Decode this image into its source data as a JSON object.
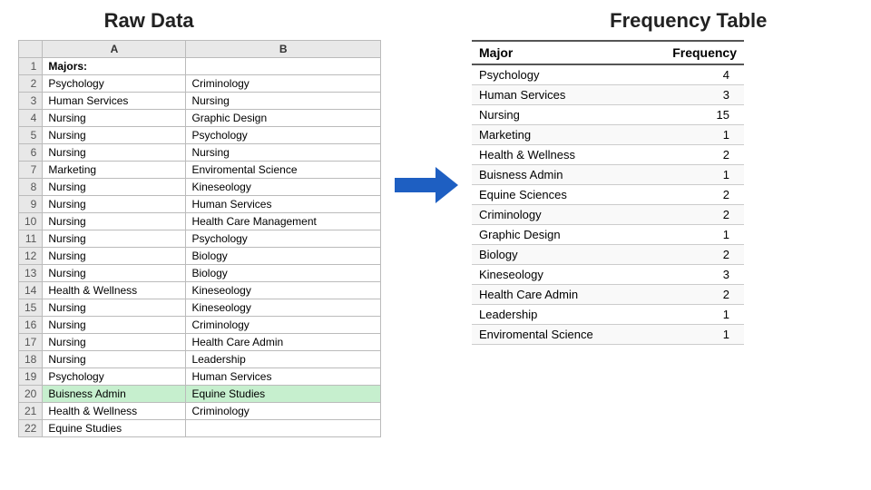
{
  "titles": {
    "raw_data": "Raw Data",
    "frequency_table": "Frequency Table"
  },
  "raw_data": {
    "col_headers": [
      "",
      "A",
      "B"
    ],
    "rows": [
      {
        "num": "1",
        "a": "Majors:",
        "b": "",
        "highlight": false
      },
      {
        "num": "2",
        "a": "Psychology",
        "b": "Criminology",
        "highlight": false
      },
      {
        "num": "3",
        "a": "Human Services",
        "b": "Nursing",
        "highlight": false
      },
      {
        "num": "4",
        "a": "Nursing",
        "b": "Graphic Design",
        "highlight": false
      },
      {
        "num": "5",
        "a": "Nursing",
        "b": "Psychology",
        "highlight": false
      },
      {
        "num": "6",
        "a": "Nursing",
        "b": "Nursing",
        "highlight": false
      },
      {
        "num": "7",
        "a": "Marketing",
        "b": "Enviromental Science",
        "highlight": false
      },
      {
        "num": "8",
        "a": "Nursing",
        "b": "Kineseology",
        "highlight": false
      },
      {
        "num": "9",
        "a": "Nursing",
        "b": "Human Services",
        "highlight": false
      },
      {
        "num": "10",
        "a": "Nursing",
        "b": "Health Care Management",
        "highlight": false
      },
      {
        "num": "11",
        "a": "Nursing",
        "b": "Psychology",
        "highlight": false
      },
      {
        "num": "12",
        "a": "Nursing",
        "b": "Biology",
        "highlight": false
      },
      {
        "num": "13",
        "a": "Nursing",
        "b": "Biology",
        "highlight": false
      },
      {
        "num": "14",
        "a": "Health & Wellness",
        "b": "Kineseology",
        "highlight": false
      },
      {
        "num": "15",
        "a": "Nursing",
        "b": "Kineseology",
        "highlight": false
      },
      {
        "num": "16",
        "a": "Nursing",
        "b": "Criminology",
        "highlight": false
      },
      {
        "num": "17",
        "a": "Nursing",
        "b": "Health Care Admin",
        "highlight": false
      },
      {
        "num": "18",
        "a": "Nursing",
        "b": "Leadership",
        "highlight": false
      },
      {
        "num": "19",
        "a": "Psychology",
        "b": "Human Services",
        "highlight": false
      },
      {
        "num": "20",
        "a": "Buisness Admin",
        "b": "Equine Studies",
        "highlight": true
      },
      {
        "num": "21",
        "a": "Health & Wellness",
        "b": "Criminology",
        "highlight": false
      },
      {
        "num": "22",
        "a": "Equine Studies",
        "b": "",
        "highlight": false
      }
    ]
  },
  "frequency_table": {
    "headers": {
      "major": "Major",
      "frequency": "Frequency"
    },
    "rows": [
      {
        "major": "Psychology",
        "frequency": "4"
      },
      {
        "major": "Human Services",
        "frequency": "3"
      },
      {
        "major": "Nursing",
        "frequency": "15"
      },
      {
        "major": "Marketing",
        "frequency": "1"
      },
      {
        "major": "Health & Wellness",
        "frequency": "2"
      },
      {
        "major": "Buisness Admin",
        "frequency": "1"
      },
      {
        "major": "Equine Sciences",
        "frequency": "2"
      },
      {
        "major": "Criminology",
        "frequency": "2"
      },
      {
        "major": "Graphic Design",
        "frequency": "1"
      },
      {
        "major": "Biology",
        "frequency": "2"
      },
      {
        "major": "Kineseology",
        "frequency": "3"
      },
      {
        "major": "Health Care Admin",
        "frequency": "2"
      },
      {
        "major": "Leadership",
        "frequency": "1"
      },
      {
        "major": "Enviromental Science",
        "frequency": "1"
      }
    ]
  }
}
